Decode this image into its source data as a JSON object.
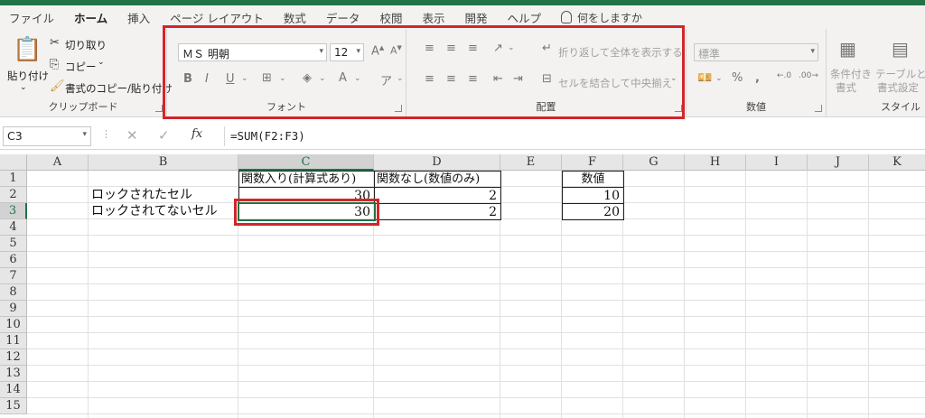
{
  "tabs": [
    "ファイル",
    "ホーム",
    "挿入",
    "ページ レイアウト",
    "数式",
    "データ",
    "校閲",
    "表示",
    "開発",
    "ヘルプ"
  ],
  "active_tab": "ホーム",
  "tell_me": "何をしますか",
  "clipboard": {
    "paste": "貼り付け",
    "cut": "切り取り",
    "copy": "コピー",
    "format_painter": "書式のコピー/貼り付け",
    "group_label": "クリップボード"
  },
  "font": {
    "family": "ＭＳ 明朝",
    "size": "12",
    "group_label": "フォント"
  },
  "alignment": {
    "wrap_text": "折り返して全体を表示する",
    "merge_center": "セルを結合して中央揃え",
    "group_label": "配置"
  },
  "number": {
    "format": "標準",
    "group_label": "数値"
  },
  "styles": {
    "conditional": "条件付き",
    "conditional2": "書式",
    "table": "テーブルとして",
    "table2": "書式設定",
    "group_label": "スタイル"
  },
  "formula_bar": {
    "name_box": "C3",
    "fx": "fx",
    "formula": "=SUM(F2:F3)"
  },
  "columns": [
    "A",
    "B",
    "C",
    "D",
    "E",
    "F",
    "G",
    "H",
    "I",
    "J",
    "K"
  ],
  "rows": [
    "1",
    "2",
    "3",
    "4",
    "5",
    "6",
    "7",
    "8",
    "9",
    "10",
    "11",
    "12",
    "13",
    "14",
    "15"
  ],
  "cells": {
    "C1": "関数入り(計算式あり)",
    "D1": "関数なし(数値のみ)",
    "F1": "数値",
    "B2": "ロックされたセル",
    "C2": "30",
    "D2": "2",
    "F2": "10",
    "B3": "ロックされてないセル",
    "C3": "30",
    "D3": "2",
    "F3": "20"
  },
  "colors": {
    "accent": "#217346",
    "highlight": "#d3252b"
  }
}
